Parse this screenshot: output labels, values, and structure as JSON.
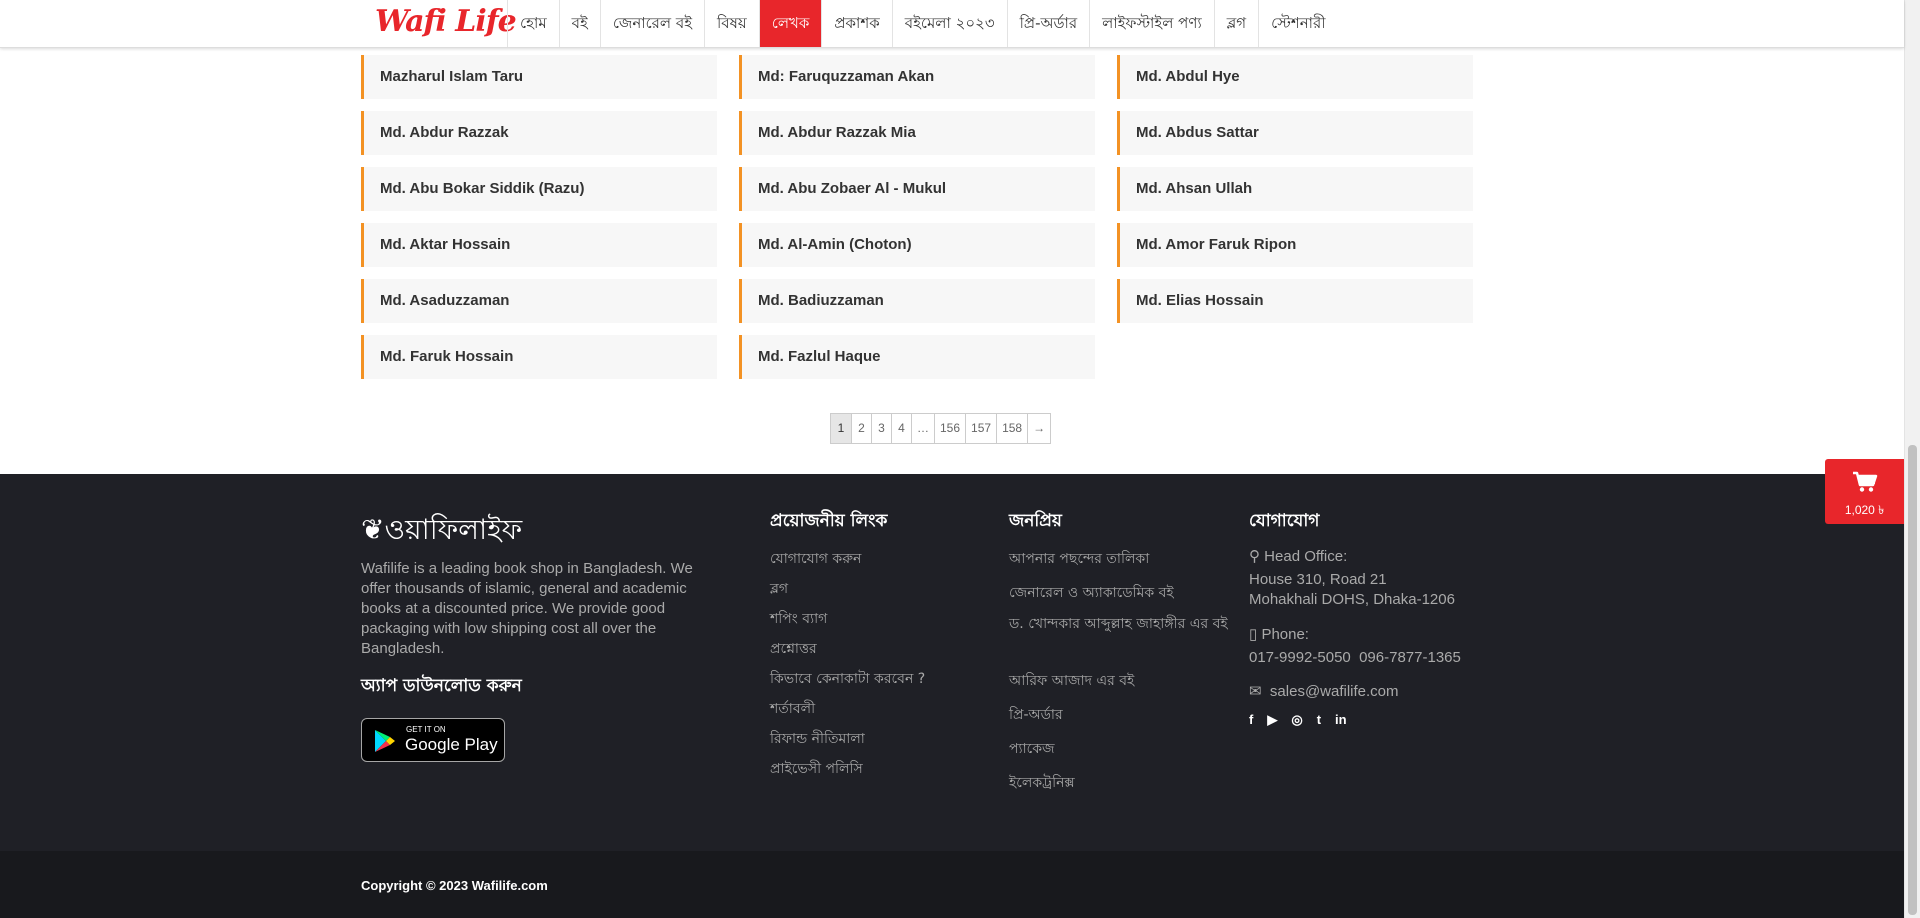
{
  "brand": {
    "logo_text": "Wafi Life",
    "accent": "#e8262b"
  },
  "nav": {
    "items": [
      {
        "label": "হোম"
      },
      {
        "label": "বই"
      },
      {
        "label": "জেনারেল বই"
      },
      {
        "label": "বিষয়"
      },
      {
        "label": "লেখক",
        "active": true
      },
      {
        "label": "প্রকাশক"
      },
      {
        "label": "বইমেলা ২০২৩"
      },
      {
        "label": "প্রি-অর্ডার"
      },
      {
        "label": "লাইফস্টাইল পণ্য"
      },
      {
        "label": "ব্লগ"
      },
      {
        "label": "স্টেশনারী"
      }
    ]
  },
  "authors": [
    "Mazharul Islam Taru",
    "Md: Faruquzzaman Akan",
    "Md. Abdul Hye",
    "Md. Abdur Razzak",
    "Md. Abdur Razzak Mia",
    "Md. Abdus Sattar",
    "Md. Abu Bokar Siddik (Razu)",
    "Md. Abu Zobaer Al - Mukul",
    "Md. Ahsan Ullah",
    "Md. Aktar Hossain",
    "Md. Al-Amin (Choton)",
    "Md. Amor Faruk Ripon",
    "Md. Asaduzzaman",
    "Md. Badiuzzaman",
    "Md. Elias Hossain",
    "Md. Faruk Hossain",
    "Md. Fazlul Haque"
  ],
  "pagination": {
    "pages": [
      "1",
      "2",
      "3",
      "4",
      "…",
      "156",
      "157",
      "158",
      "→"
    ],
    "current": "1"
  },
  "cart": {
    "total": "1,020 ৳",
    "icon": "shopping-cart-icon"
  },
  "footer": {
    "logo_text": "ওয়াফিলাইফ",
    "about": "Wafilife is a leading book shop in Bangladesh. We offer thousands of islamic, general and academic books at a discounted price. We provide good packaging with low shipping cost all over the Bangladesh.",
    "app_title": "অ্যাপ ডাউনলোড করুন",
    "google_play": {
      "small": "GET IT ON",
      "big": "Google Play"
    },
    "useful_links": {
      "title": "প্রয়োজনীয় লিংক",
      "items": [
        "যোগাযোগ করুন",
        "ব্লগ",
        "শপিং ব্যাগ",
        "প্রশ্নোত্তর",
        "কিভাবে কেনাকাটা করবেন ?",
        "শর্তাবলী",
        "রিফান্ড নীতিমালা",
        "প্রাইভেসী পলিসি"
      ]
    },
    "popular": {
      "title": "জনপ্রিয়",
      "items": [
        "আপনার পছন্দের তালিকা",
        "জেনারেল ও অ্যাকাডেমিক বই",
        "ড. খোন্দকার আব্দুল্লাহ জাহাঙ্গীর এর বই",
        "আরিফ আজাদ এর বই",
        "প্রি-অর্ডার",
        "প্যাকেজ",
        "ইলেকট্রনিক্স"
      ]
    },
    "contact": {
      "title": "যোগাযোগ",
      "head_office_label": "Head Office:",
      "address_line1": "House 310, Road 21",
      "address_line2": "Mohakhali DOHS, Dhaka-1206",
      "phone_label": "Phone:",
      "phones": "017-9992-5050  096-7877-1365",
      "email": "sales@wafilife.com"
    },
    "social": [
      "f",
      "▶",
      "◎",
      "t",
      "in"
    ],
    "copyright": "Copyright © 2023 Wafilife.com"
  }
}
